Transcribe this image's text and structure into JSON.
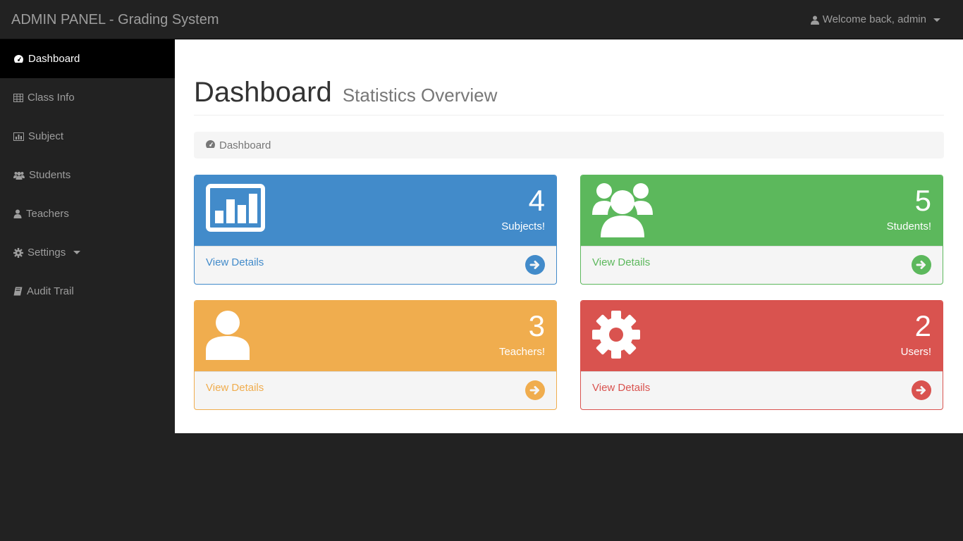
{
  "navbar": {
    "brand": "ADMIN PANEL - Grading System",
    "user_label": "Welcome back, admin",
    "user_icon": "user-icon"
  },
  "sidebar": {
    "items": [
      {
        "label": "Dashboard",
        "icon": "dashboard-icon",
        "active": true
      },
      {
        "label": "Class Info",
        "icon": "table-icon"
      },
      {
        "label": "Subject",
        "icon": "bar-chart-icon"
      },
      {
        "label": "Students",
        "icon": "users-icon"
      },
      {
        "label": "Teachers",
        "icon": "user-icon"
      },
      {
        "label": "Settings",
        "icon": "gear-icon"
      },
      {
        "label": "Audit Trail",
        "icon": "book-icon"
      }
    ]
  },
  "header": {
    "title": "Dashboard",
    "subtitle": "Statistics Overview"
  },
  "breadcrumb": {
    "label": "Dashboard",
    "icon": "dashboard-icon"
  },
  "panels": [
    {
      "count": "4",
      "label": "Subjects!",
      "link": "View Details",
      "color": "#428bca",
      "icon": "bar-chart-icon"
    },
    {
      "count": "5",
      "label": "Students!",
      "link": "View Details",
      "color": "#5cb85c",
      "icon": "users-icon"
    },
    {
      "count": "3",
      "label": "Teachers!",
      "link": "View Details",
      "color": "#f0ad4e",
      "icon": "user-icon"
    },
    {
      "count": "2",
      "label": "Users!",
      "link": "View Details",
      "color": "#d9534f",
      "icon": "gear-icon"
    }
  ]
}
